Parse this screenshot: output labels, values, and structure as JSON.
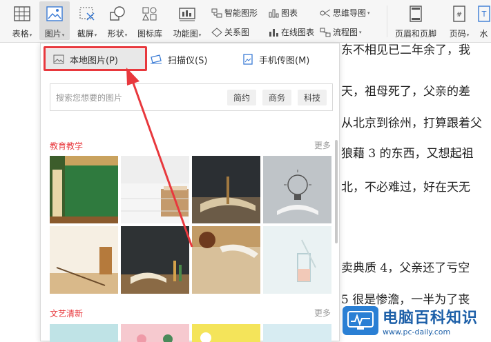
{
  "toolbar": {
    "table": "表格",
    "picture": "图片",
    "screenshot": "截屏",
    "shape": "形状",
    "icon_lib": "图标库",
    "func_chart": "功能图",
    "smart_art": "智能图形",
    "relation": "关系图",
    "chart": "图表",
    "online_chart": "在线图表",
    "mindmap": "思维导图",
    "flowchart": "流程图",
    "header_footer": "页眉和页脚",
    "page_number": "页码",
    "water": "水"
  },
  "picture_menu": {
    "local": "本地图片(P)",
    "scanner": "扫描仪(S)",
    "phone": "手机传图(M)",
    "search_placeholder": "搜索您想要的图片",
    "tags": [
      "简约",
      "商务",
      "科技"
    ],
    "categories": [
      {
        "title": "教育教学",
        "more": "更多"
      },
      {
        "title": "文艺清新",
        "more": "更多"
      }
    ]
  },
  "document": {
    "lines": [
      "东不相见已二年余了，我",
      "天，祖母死了，父亲的差",
      "从北京到徐州，打算跟着父",
      "狼藉 3 的东西，又想起祖",
      "北，不必难过，好在天无",
      "卖典质 4，父亲还了亏空",
      "5 很是惨澹，一半为了丧"
    ]
  },
  "watermark": {
    "title": "电脑百科知识",
    "url": "www.pc-daily.com"
  },
  "colors": {
    "accent_red": "#e8383d",
    "brand_blue": "#1c5fa8"
  }
}
